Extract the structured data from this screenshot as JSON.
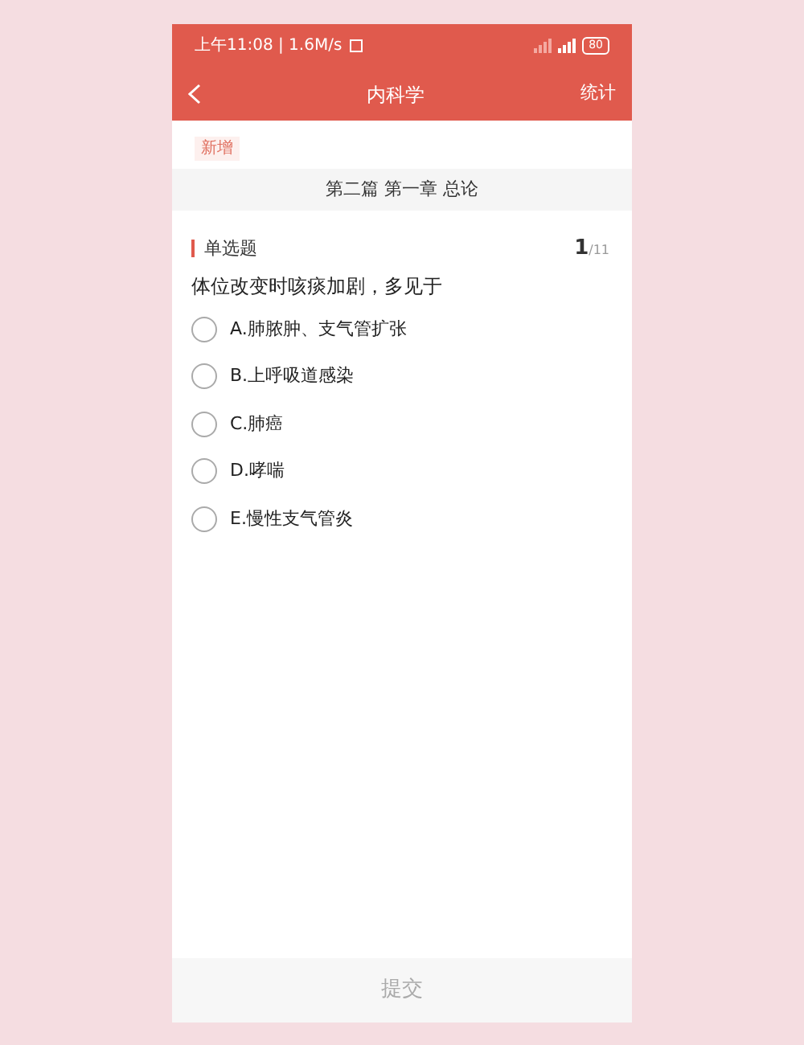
{
  "status_bar": {
    "time": "上午11:08 | 1.6M/s",
    "battery": "80"
  },
  "nav": {
    "title": "内科学",
    "action": "统计"
  },
  "tag": "新增",
  "section": "第二篇 第一章 总论",
  "question": {
    "type": "单选题",
    "number": "1",
    "total": "/11",
    "text": "体位改变时咳痰加剧，多见于",
    "options": [
      {
        "label": "A.肺脓肿、支气管扩张",
        "selected": false
      },
      {
        "label": "B.上呼吸道感染",
        "selected": false
      },
      {
        "label": "C.肺癌",
        "selected": false
      },
      {
        "label": "D.哮喘",
        "selected": false
      },
      {
        "label": "E.慢性支气管炎",
        "selected": false
      }
    ]
  },
  "submit": "提交"
}
